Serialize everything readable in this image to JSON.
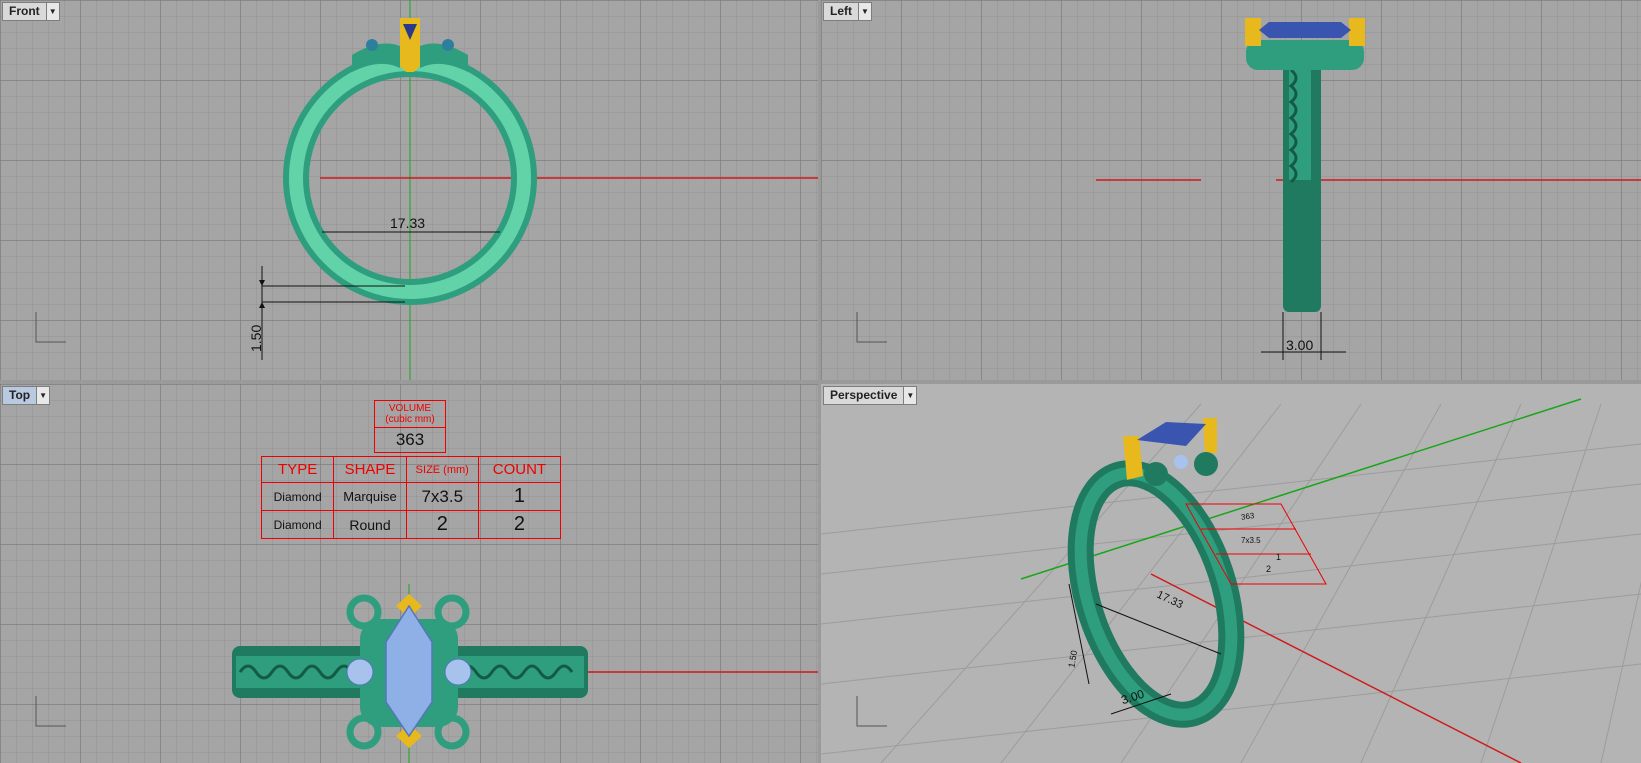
{
  "viewports": {
    "front": {
      "title": "Front",
      "dims": {
        "diameter": "17.33",
        "thickness": "1.50"
      }
    },
    "left": {
      "title": "Left",
      "dims": {
        "width": "3.00"
      }
    },
    "top": {
      "title": "Top"
    },
    "perspective": {
      "title": "Perspective",
      "dims": {
        "diameter": "17.33",
        "thickness": "1.50",
        "width": "3.00"
      },
      "table_echo": {
        "volume": "363",
        "size1": "7x3.5",
        "count1": "1",
        "count2": "2"
      }
    }
  },
  "specs": {
    "volume_label_1": "VOLUME",
    "volume_label_2": "(cubic mm)",
    "volume": "363",
    "headers": {
      "type": "TYPE",
      "shape": "SHAPE",
      "size": "SIZE (mm)",
      "count": "COUNT"
    },
    "rows": [
      {
        "type": "Diamond",
        "shape": "Marquise",
        "size": "7x3.5",
        "count": "1"
      },
      {
        "type": "Diamond",
        "shape": "Round",
        "size": "2",
        "count": "2"
      }
    ]
  },
  "colors": {
    "band": "#2e9e7e",
    "band_light": "#5ecfa6",
    "prong": "#e8b91c",
    "stone": "#8fb0e6",
    "axis_x": "#d11a1a",
    "axis_y": "#1aa51a"
  }
}
